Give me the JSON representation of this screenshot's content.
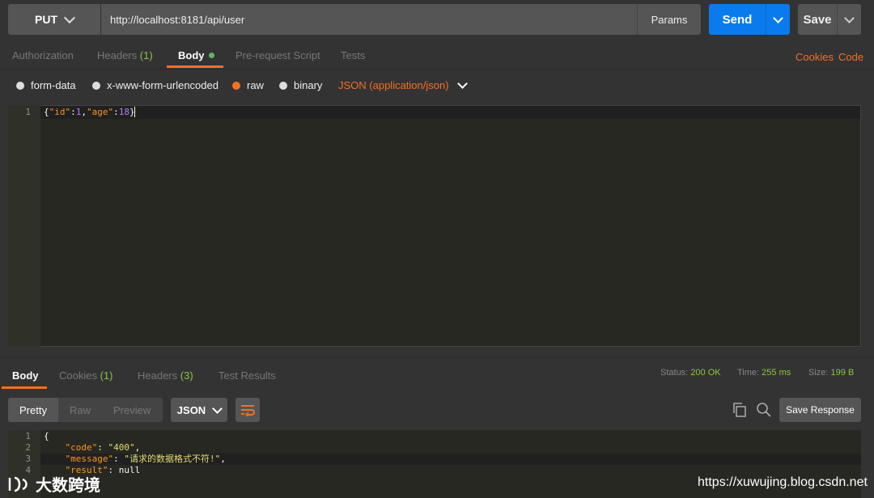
{
  "request": {
    "method": "PUT",
    "url": "http://localhost:8181/api/user",
    "params_label": "Params",
    "send_label": "Send",
    "save_label": "Save"
  },
  "tabs": {
    "authorization": "Authorization",
    "headers": "Headers",
    "headers_count": "(1)",
    "body": "Body",
    "prerequest": "Pre-request Script",
    "tests": "Tests",
    "cookies": "Cookies",
    "code": "Code"
  },
  "body_types": {
    "form_data": "form-data",
    "urlencoded": "x-www-form-urlencoded",
    "raw": "raw",
    "binary": "binary",
    "content_type": "JSON (application/json)"
  },
  "editor": {
    "line_numbers": [
      "1"
    ],
    "lines": [
      [
        {
          "t": "{",
          "c": "jp"
        },
        {
          "t": "\"id\"",
          "c": "jk"
        },
        {
          "t": ":",
          "c": "jp"
        },
        {
          "t": "1",
          "c": "jn"
        },
        {
          "t": ",",
          "c": "jp"
        },
        {
          "t": "\"age\"",
          "c": "jk"
        },
        {
          "t": ":",
          "c": "jp"
        },
        {
          "t": "18",
          "c": "jn"
        },
        {
          "t": "}",
          "c": "jp"
        }
      ]
    ]
  },
  "response": {
    "tabs": {
      "body": "Body",
      "cookies": "Cookies",
      "cookies_count": "(1)",
      "headers": "Headers",
      "headers_count": "(3)",
      "test_results": "Test Results"
    },
    "status_label": "Status:",
    "status_value": "200 OK",
    "time_label": "Time:",
    "time_value": "255 ms",
    "size_label": "Size:",
    "size_value": "199 B",
    "views": {
      "pretty": "Pretty",
      "raw": "Raw",
      "preview": "Preview"
    },
    "format": "JSON",
    "save_response": "Save Response",
    "line_numbers": [
      "1",
      "2",
      "3",
      "4"
    ],
    "lines": [
      [
        {
          "t": "{",
          "c": "jp"
        }
      ],
      [
        {
          "t": "    \"code\"",
          "c": "jk"
        },
        {
          "t": ": ",
          "c": "jp"
        },
        {
          "t": "\"400\"",
          "c": "js"
        },
        {
          "t": ",",
          "c": "jp"
        }
      ],
      [
        {
          "t": "    \"message\"",
          "c": "jk"
        },
        {
          "t": ": ",
          "c": "jp"
        },
        {
          "t": "\"请求的数据格式不符!\"",
          "c": "js"
        },
        {
          "t": ",",
          "c": "jp"
        }
      ],
      [
        {
          "t": "    \"result\"",
          "c": "jk"
        },
        {
          "t": ": ",
          "c": "jp"
        },
        {
          "t": "null",
          "c": "jnull"
        }
      ]
    ]
  },
  "watermark": {
    "site": "https://xuwujing.blog.csdn.net",
    "logo_text": "大数跨境"
  },
  "colors": {
    "accent": "#f47023",
    "send": "#097bed",
    "success": "#8dc63f"
  }
}
